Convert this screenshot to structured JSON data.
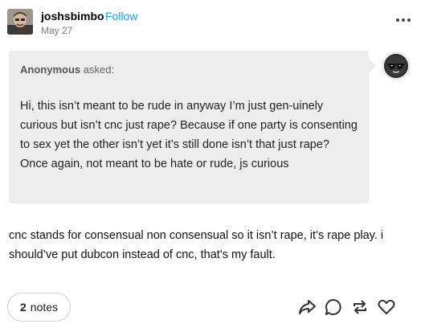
{
  "post": {
    "username": "joshsbimbo",
    "follow_label": "Follow",
    "date": "May 27",
    "more_icon": "ellipsis-icon"
  },
  "ask": {
    "asker": "Anonymous",
    "asked_label": "asked:",
    "question": "Hi, this isn’t meant to be rude in anyway I’m just gen-uinely curious but isn’t cnc just rape? Because if one party is consenting to sex yet the other isn’t yet it’s still done isn’t that just rape? Once again, not meant to be hate or rude, js curious",
    "bubble_color": "#ededed"
  },
  "answer": {
    "text": "cnc stands for consensual non consensual so it isn’t rape, it’s rape play. i should’ve put dubcon instead of cnc, that’s my fault."
  },
  "footer": {
    "notes_count": "2",
    "notes_label": "notes",
    "actions": [
      "share-icon",
      "reply-icon",
      "reblog-icon",
      "like-icon"
    ]
  },
  "colors": {
    "follow": "#1a9cf0",
    "meta": "#7a7a7a",
    "ask_bg": "#ededed"
  }
}
